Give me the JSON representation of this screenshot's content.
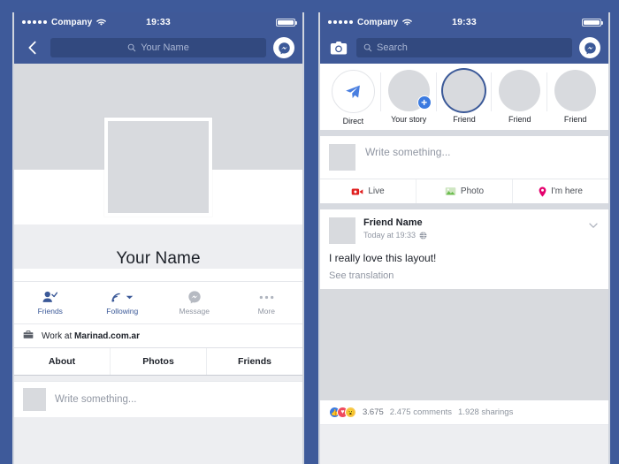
{
  "theme": {
    "brand_blue": "#3b5998",
    "page_bg": "#3e5a9a",
    "search_field": "#32497f",
    "placeholder": "#a9b6d4",
    "gray_placeholder": "#d8dade"
  },
  "left_phone": {
    "status_bar": {
      "carrier": "Company",
      "signal_dots": 5,
      "wifi_icon": "wifi-icon",
      "time": "19:33",
      "battery_icon": "battery-full-icon"
    },
    "nav": {
      "back_icon": "chevron-left-icon",
      "search_icon": "search-icon",
      "search_value": "Your Name",
      "messenger_icon": "messenger-icon"
    },
    "profile": {
      "cover_photo": "cover-photo-placeholder",
      "profile_picture": "profile-picture-placeholder",
      "name": "Your Name"
    },
    "actions": [
      {
        "label": "Friends",
        "icon": "friend-check-icon",
        "state": "active"
      },
      {
        "label": "Following",
        "icon": "rss-following-icon",
        "state": "active"
      },
      {
        "label": "Message",
        "icon": "messenger-icon",
        "state": "muted"
      },
      {
        "label": "More",
        "icon": "ellipsis-icon",
        "state": "muted"
      }
    ],
    "work": {
      "icon": "briefcase-icon",
      "prefix": "Work at ",
      "employer": "Marinad.com.ar"
    },
    "tabs": [
      {
        "label": "About"
      },
      {
        "label": "Photos"
      },
      {
        "label": "Friends"
      }
    ],
    "composer": {
      "avatar": "avatar-placeholder",
      "placeholder": "Write something..."
    }
  },
  "right_phone": {
    "status_bar": {
      "carrier": "Company",
      "signal_dots": 5,
      "wifi_icon": "wifi-icon",
      "time": "19:33",
      "battery_icon": "battery-full-icon"
    },
    "nav": {
      "camera_icon": "camera-icon",
      "search_icon": "search-icon",
      "search_placeholder": "Search",
      "messenger_icon": "messenger-icon"
    },
    "stories": [
      {
        "label": "Direct",
        "icon": "paper-plane-icon",
        "type": "direct"
      },
      {
        "label": "Your story",
        "type": "add",
        "add_icon": "plus-icon"
      },
      {
        "label": "Friend",
        "type": "unseen"
      },
      {
        "label": "Friend",
        "type": "seen"
      },
      {
        "label": "Friend",
        "type": "seen"
      }
    ],
    "composer": {
      "avatar": "avatar-placeholder",
      "placeholder": "Write something..."
    },
    "quick_actions": [
      {
        "label": "Live",
        "icon": "live-video-icon",
        "color": "#e02020"
      },
      {
        "label": "Photo",
        "icon": "photo-icon",
        "color": "#6bbd4e"
      },
      {
        "label": "I'm here",
        "icon": "location-pin-icon",
        "color": "#e4006d"
      }
    ],
    "post": {
      "avatar": "avatar-placeholder",
      "author": "Friend Name",
      "timestamp": "Today at 19:33",
      "privacy_icon": "globe-icon",
      "menu_icon": "chevron-down-icon",
      "text": "I really love this layout!",
      "translate_link": "See translation",
      "image": "post-image-placeholder",
      "reactions": [
        {
          "name": "like",
          "icon": "thumbs-up-icon",
          "color": "#3b7ae0"
        },
        {
          "name": "love",
          "icon": "heart-icon",
          "color": "#ef4a5e"
        },
        {
          "name": "wow",
          "icon": "wow-face-icon",
          "color": "#f7c94b"
        }
      ],
      "reaction_count": "3.675",
      "comments": "2.475 comments",
      "shares": "1.928 sharings"
    }
  }
}
